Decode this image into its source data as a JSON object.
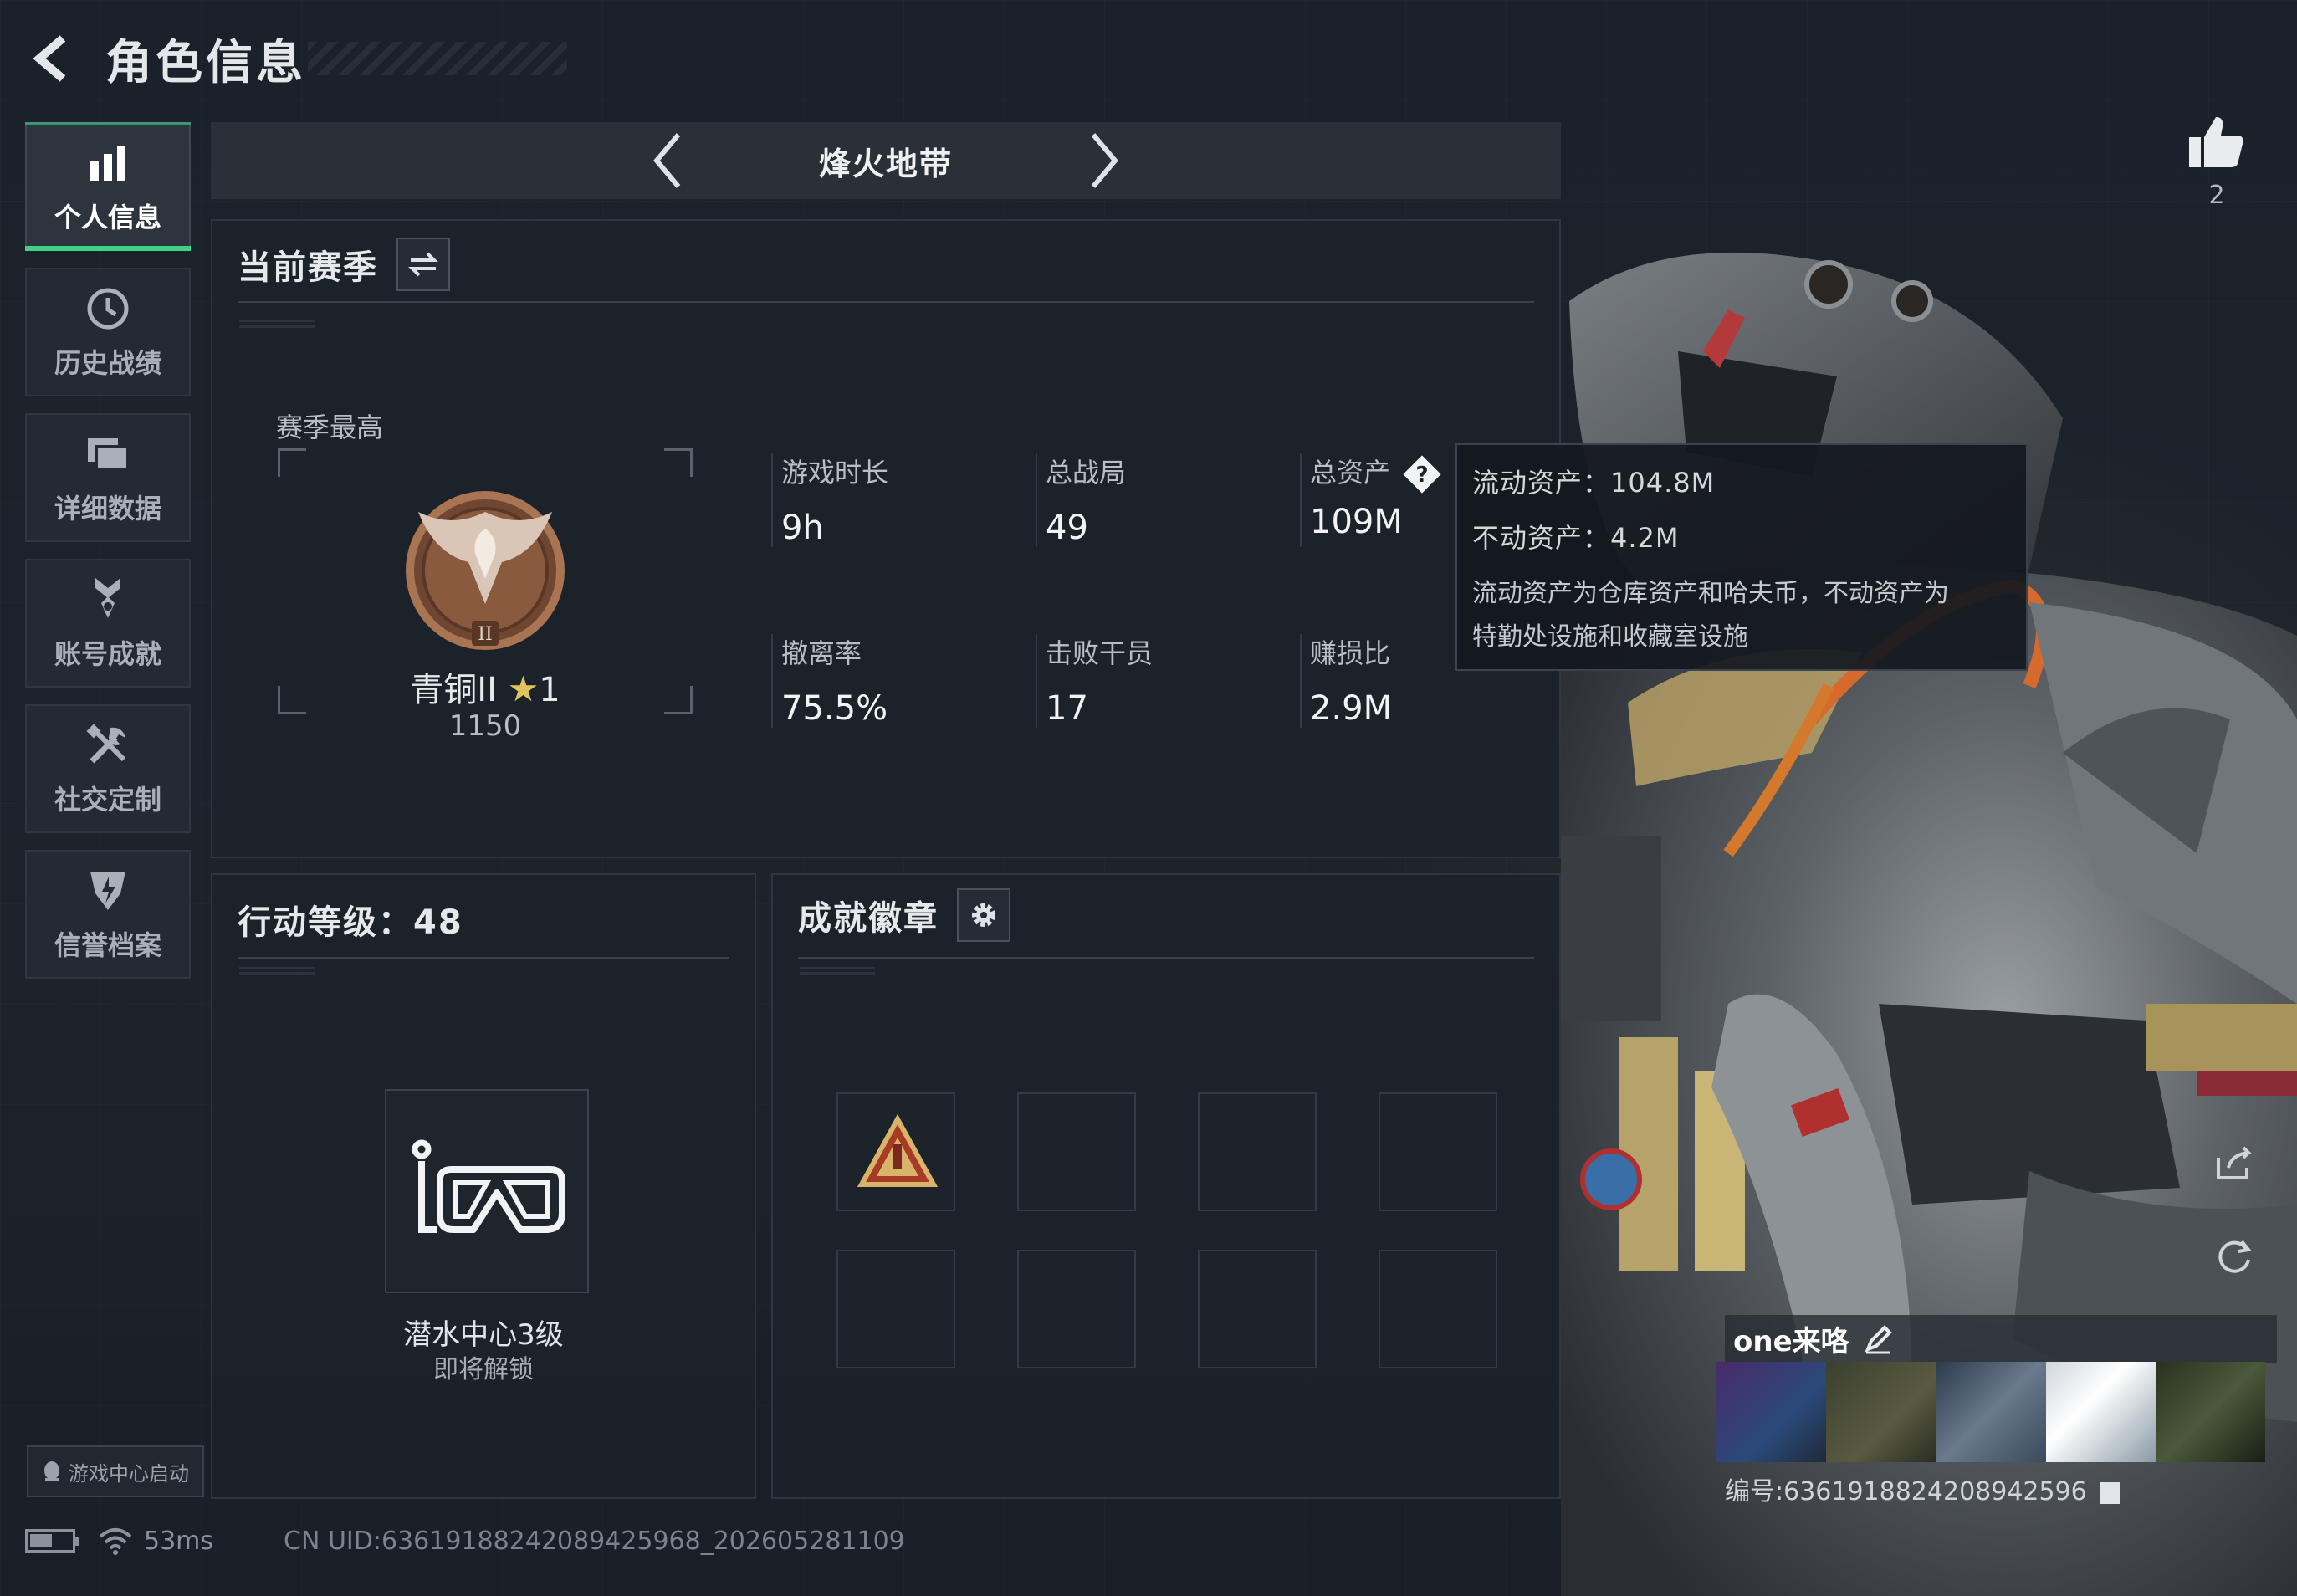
{
  "header": {
    "title": "角色信息"
  },
  "sidebar": {
    "items": [
      {
        "label": "个人信息"
      },
      {
        "label": "历史战绩"
      },
      {
        "label": "详细数据"
      },
      {
        "label": "账号成就"
      },
      {
        "label": "社交定制"
      },
      {
        "label": "信誉档案"
      }
    ],
    "game_center_label": "游戏中心启动"
  },
  "mode": {
    "title": "烽火地带"
  },
  "season": {
    "title": "当前赛季",
    "best_label": "赛季最高",
    "rank_name": "青铜II",
    "rank_star": "★",
    "rank_stars": "1",
    "rank_score": "1150",
    "emblem_numeral": "II",
    "stats": [
      {
        "key": "游戏时长",
        "value": "9h"
      },
      {
        "key": "总战局",
        "value": "49"
      },
      {
        "key": "总资产",
        "value": "109M"
      },
      {
        "key": "撤离率",
        "value": "75.5%"
      },
      {
        "key": "击败干员",
        "value": "17"
      },
      {
        "key": "赚损比",
        "value": "2.9M"
      }
    ]
  },
  "tooltip": {
    "liquid": "流动资产：104.8M",
    "fixed": "不动资产：4.2M",
    "note_line1": "流动资产为仓库资产和哈夫币，不动资产为",
    "note_line2": "特勤处设施和收藏室设施"
  },
  "level": {
    "title": "行动等级：48",
    "badge_name": "潜水中心3级",
    "badge_status": "即将解锁"
  },
  "badges": {
    "title": "成就徽章"
  },
  "like": {
    "count": "2"
  },
  "player": {
    "name": "one来咯",
    "id_line": "编号:6361918824208942596"
  },
  "footer": {
    "ping": "53ms",
    "uid": "CN UID:6361918824208942596​8_202605281109",
    "battery_level": 0.55
  },
  "colors": {
    "accent": "#3fd08a",
    "bronze": "#8a5a3e",
    "gold": "#e2c25a"
  }
}
